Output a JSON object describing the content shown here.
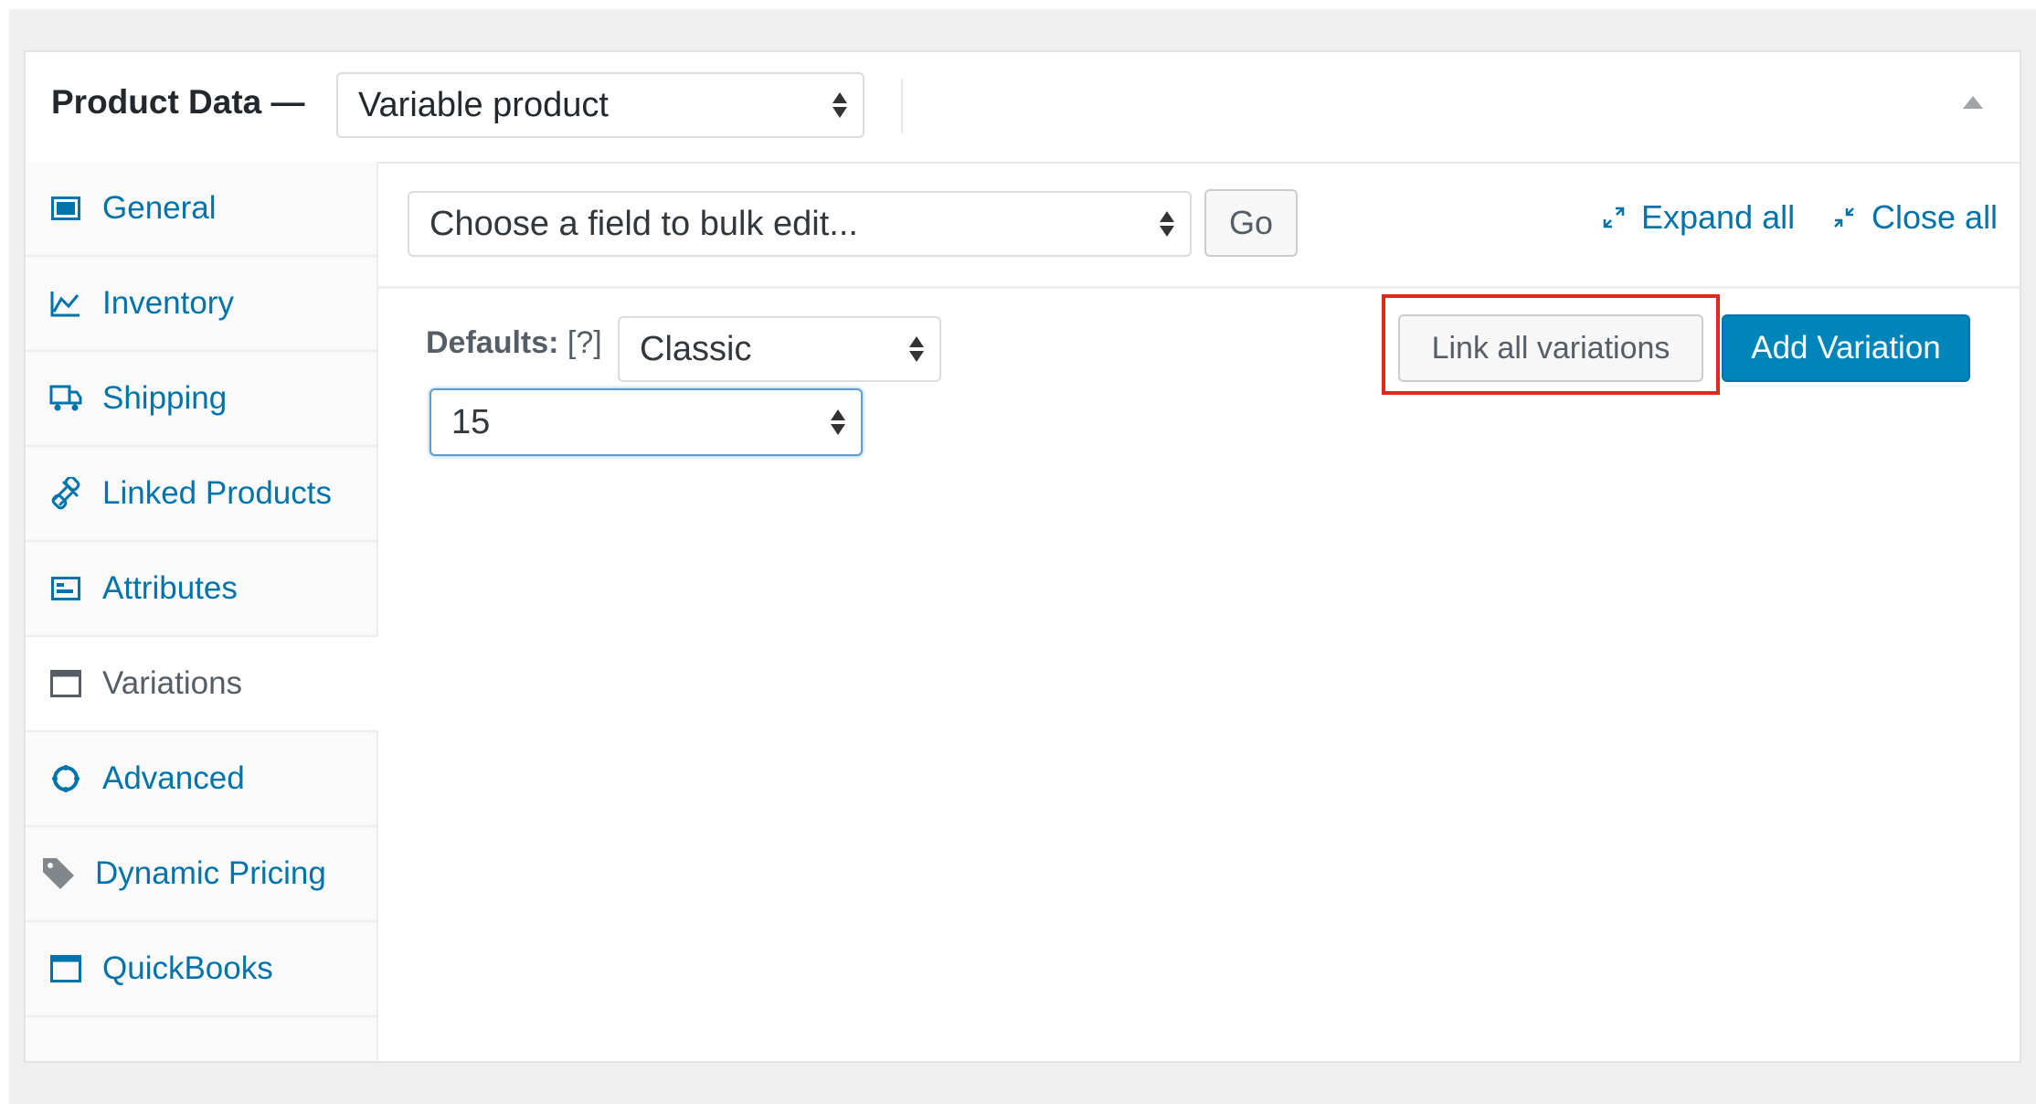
{
  "panel": {
    "title": "Product Data —",
    "product_type": "Variable product"
  },
  "tabs": [
    {
      "label": "General",
      "icon": "general-icon"
    },
    {
      "label": "Inventory",
      "icon": "inventory-icon"
    },
    {
      "label": "Shipping",
      "icon": "shipping-icon"
    },
    {
      "label": "Linked Products",
      "icon": "link-icon"
    },
    {
      "label": "Attributes",
      "icon": "attributes-icon"
    },
    {
      "label": "Variations",
      "icon": "variations-icon",
      "active": true
    },
    {
      "label": "Advanced",
      "icon": "gear-icon"
    },
    {
      "label": "Dynamic Pricing",
      "icon": "tag-icon"
    },
    {
      "label": "QuickBooks",
      "icon": "window-icon"
    }
  ],
  "toolbar": {
    "bulk_placeholder": "Choose a field to bulk edit...",
    "go_label": "Go",
    "expand_all": "Expand all",
    "close_all": "Close all"
  },
  "defaults": {
    "label": "Defaults:",
    "help": "[?]",
    "attribute_value": "Classic",
    "second_value": "15"
  },
  "actions": {
    "link_all": "Link all variations",
    "add_variation": "Add Variation"
  },
  "colors": {
    "link": "#0073aa",
    "primary_button": "#0085ba",
    "highlight": "#e0281c"
  }
}
